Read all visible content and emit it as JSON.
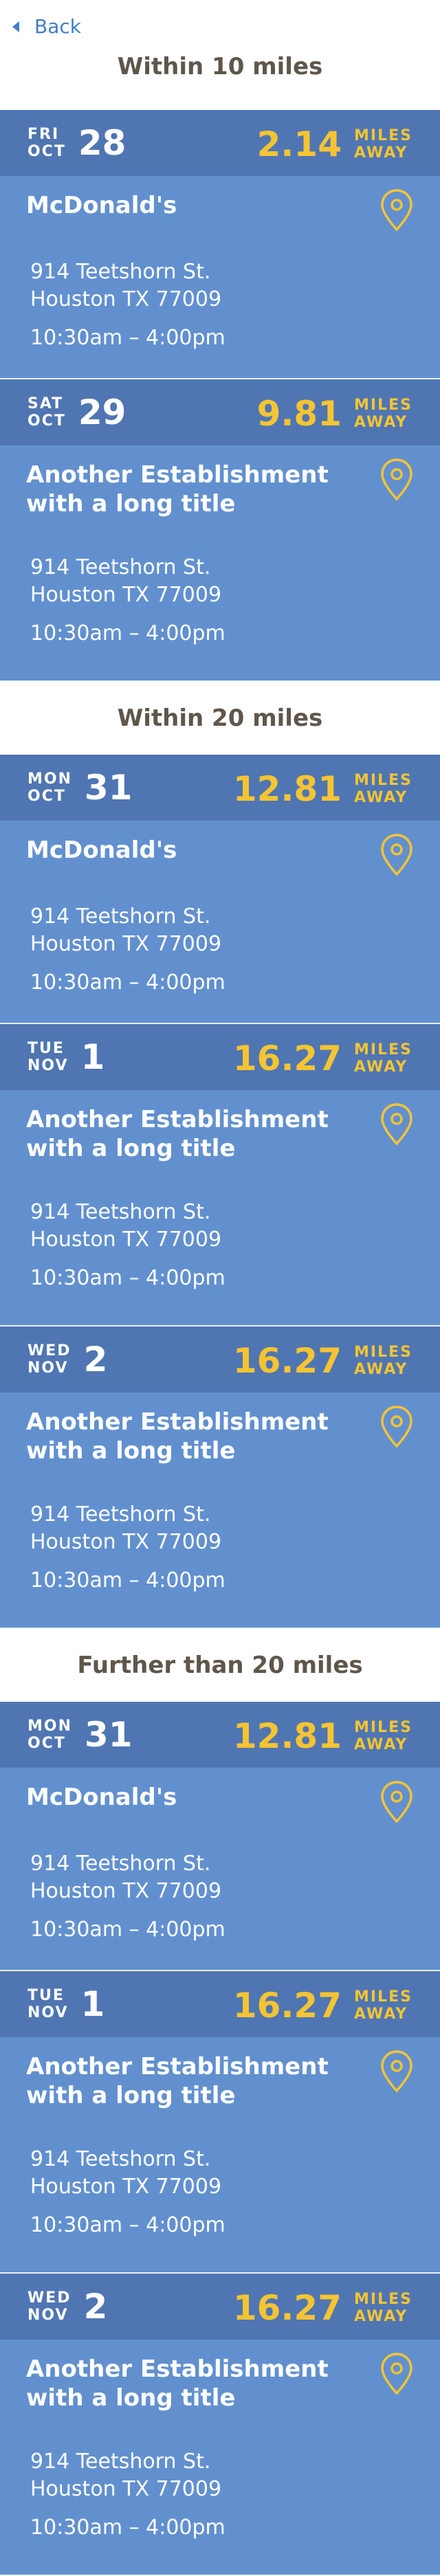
{
  "nav": {
    "back_label": "Back"
  },
  "sections": [
    {
      "title": "Within 10 miles",
      "cards": [
        {
          "dow": "FRI",
          "month": "OCT",
          "day": "28",
          "distance": "2.14",
          "unit1": "MILES",
          "unit2": "AWAY",
          "name": "McDonald's",
          "addr1": "914 Teetshorn St.",
          "addr2": "Houston TX 77009",
          "hours": "10:30am – 4:00pm",
          "two_line": false
        },
        {
          "dow": "SAT",
          "month": "OCT",
          "day": "29",
          "distance": "9.81",
          "unit1": "MILES",
          "unit2": "AWAY",
          "name": "Another Establishment with a long title",
          "addr1": "914 Teetshorn St.",
          "addr2": "Houston TX 77009",
          "hours": "10:30am – 4:00pm",
          "two_line": true
        }
      ]
    },
    {
      "title": "Within 20 miles",
      "cards": [
        {
          "dow": "MON",
          "month": "OCT",
          "day": "31",
          "distance": "12.81",
          "unit1": "MILES",
          "unit2": "AWAY",
          "name": "McDonald's",
          "addr1": "914 Teetshorn St.",
          "addr2": "Houston TX 77009",
          "hours": "10:30am – 4:00pm",
          "two_line": false
        },
        {
          "dow": "TUE",
          "month": "NOV",
          "day": "1",
          "distance": "16.27",
          "unit1": "MILES",
          "unit2": "AWAY",
          "name": "Another Establishment with a long title",
          "addr1": "914 Teetshorn St.",
          "addr2": "Houston TX 77009",
          "hours": "10:30am – 4:00pm",
          "two_line": true
        },
        {
          "dow": "WED",
          "month": "NOV",
          "day": "2",
          "distance": "16.27",
          "unit1": "MILES",
          "unit2": "AWAY",
          "name": "Another Establishment with a long title",
          "addr1": "914 Teetshorn St.",
          "addr2": "Houston TX 77009",
          "hours": "10:30am – 4:00pm",
          "two_line": true
        }
      ]
    },
    {
      "title": "Further than 20 miles",
      "cards": [
        {
          "dow": "MON",
          "month": "OCT",
          "day": "31",
          "distance": "12.81",
          "unit1": "MILES",
          "unit2": "AWAY",
          "name": "McDonald's",
          "addr1": "914 Teetshorn St.",
          "addr2": "Houston TX 77009",
          "hours": "10:30am – 4:00pm",
          "two_line": false
        },
        {
          "dow": "TUE",
          "month": "NOV",
          "day": "1",
          "distance": "16.27",
          "unit1": "MILES",
          "unit2": "AWAY",
          "name": "Another Establishment with a long title",
          "addr1": "914 Teetshorn St.",
          "addr2": "Houston TX 77009",
          "hours": "10:30am – 4:00pm",
          "two_line": true
        },
        {
          "dow": "WED",
          "month": "NOV",
          "day": "2",
          "distance": "16.27",
          "unit1": "MILES",
          "unit2": "AWAY",
          "name": "Another Establishment with a long title",
          "addr1": "914 Teetshorn St.",
          "addr2": "Houston TX 77009",
          "hours": "10:30am – 4:00pm",
          "two_line": true
        }
      ]
    }
  ],
  "colors": {
    "header_blue": "#4f76b2",
    "body_blue": "#6290cf",
    "accent_yellow": "#f5c433",
    "link_blue": "#3f7ec7",
    "section_text": "#5f564b"
  },
  "icons": {
    "back": "caret-left-icon",
    "location": "map-pin-icon"
  }
}
